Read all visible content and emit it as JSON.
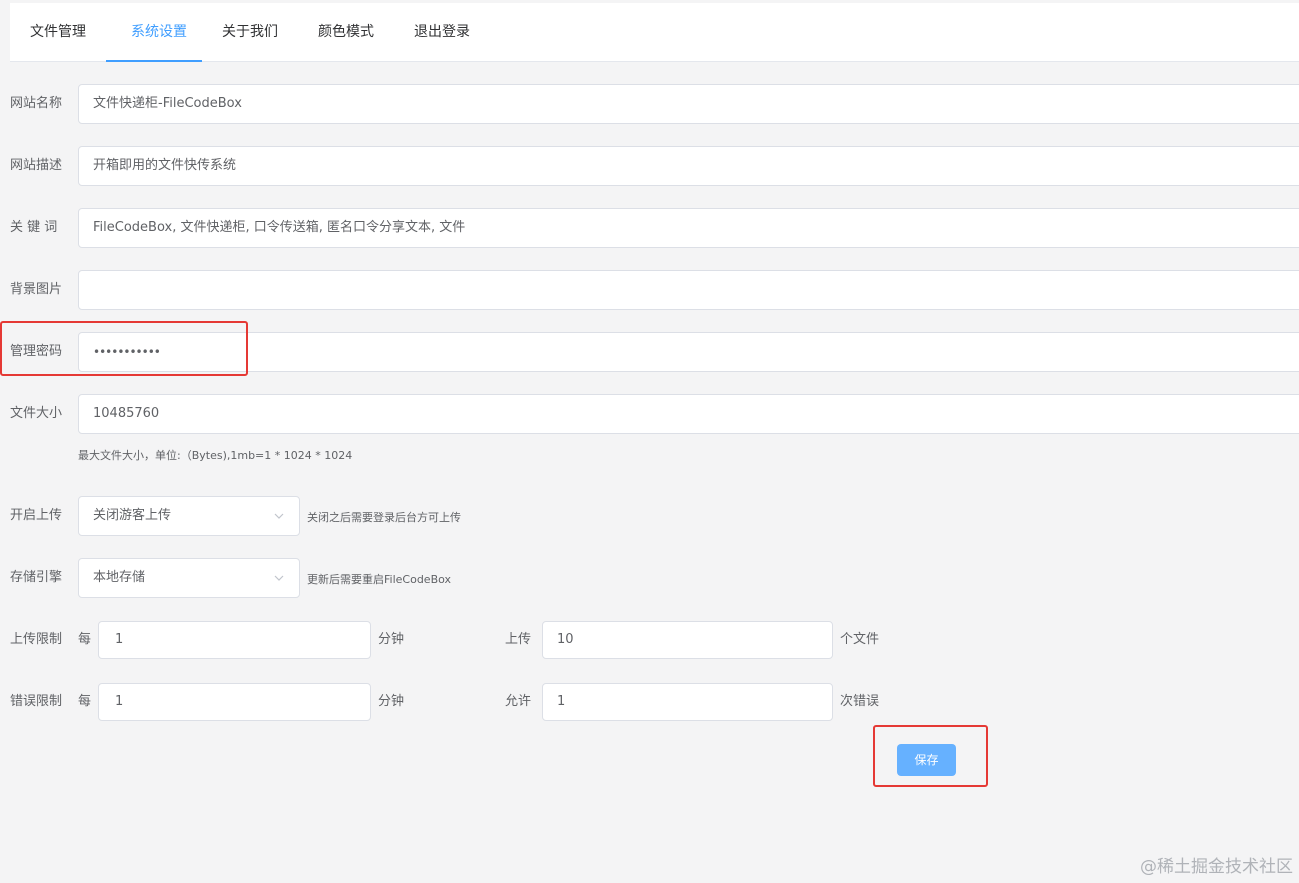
{
  "tabs": [
    {
      "label": "文件管理"
    },
    {
      "label": "系统设置"
    },
    {
      "label": "关于我们"
    },
    {
      "label": "颜色模式"
    },
    {
      "label": "退出登录"
    }
  ],
  "active_tab": "系统设置",
  "form": {
    "site_name": {
      "label": "网站名称",
      "value": "文件快递柜-FileCodeBox"
    },
    "site_desc": {
      "label": "网站描述",
      "value": "开箱即用的文件快传系统"
    },
    "keywords": {
      "label": "关 键 词",
      "value": "FileCodeBox, 文件快递柜, 口令传送箱, 匿名口令分享文本, 文件"
    },
    "background": {
      "label": "背景图片",
      "value": ""
    },
    "admin_password": {
      "label": "管理密码",
      "value": "•••••••••••"
    },
    "file_size": {
      "label": "文件大小",
      "value": "10485760",
      "hint": "最大文件大小，单位:（Bytes),1mb=1 * 1024 * 1024"
    },
    "enable_upload": {
      "label": "开启上传",
      "value": "关闭游客上传",
      "hint": "关闭之后需要登录后台方可上传"
    },
    "storage": {
      "label": "存储引擎",
      "value": "本地存储",
      "hint": "更新后需要重启FileCodeBox"
    },
    "upload_limit": {
      "label": "上传限制",
      "per": "每",
      "minutes": "1",
      "minutes_unit": "分钟",
      "allow_label": "上传",
      "count": "10",
      "count_unit": "个文件"
    },
    "error_limit": {
      "label": "错误限制",
      "per": "每",
      "minutes": "1",
      "minutes_unit": "分钟",
      "allow_label": "允许",
      "count": "1",
      "count_unit": "次错误"
    }
  },
  "save_button": {
    "label": "保存"
  },
  "watermark": "@稀土掘金技术社区",
  "colors": {
    "accent": "#409eff",
    "button": "#66b1ff",
    "highlight": "#e53935",
    "background": "#f4f4f5"
  }
}
